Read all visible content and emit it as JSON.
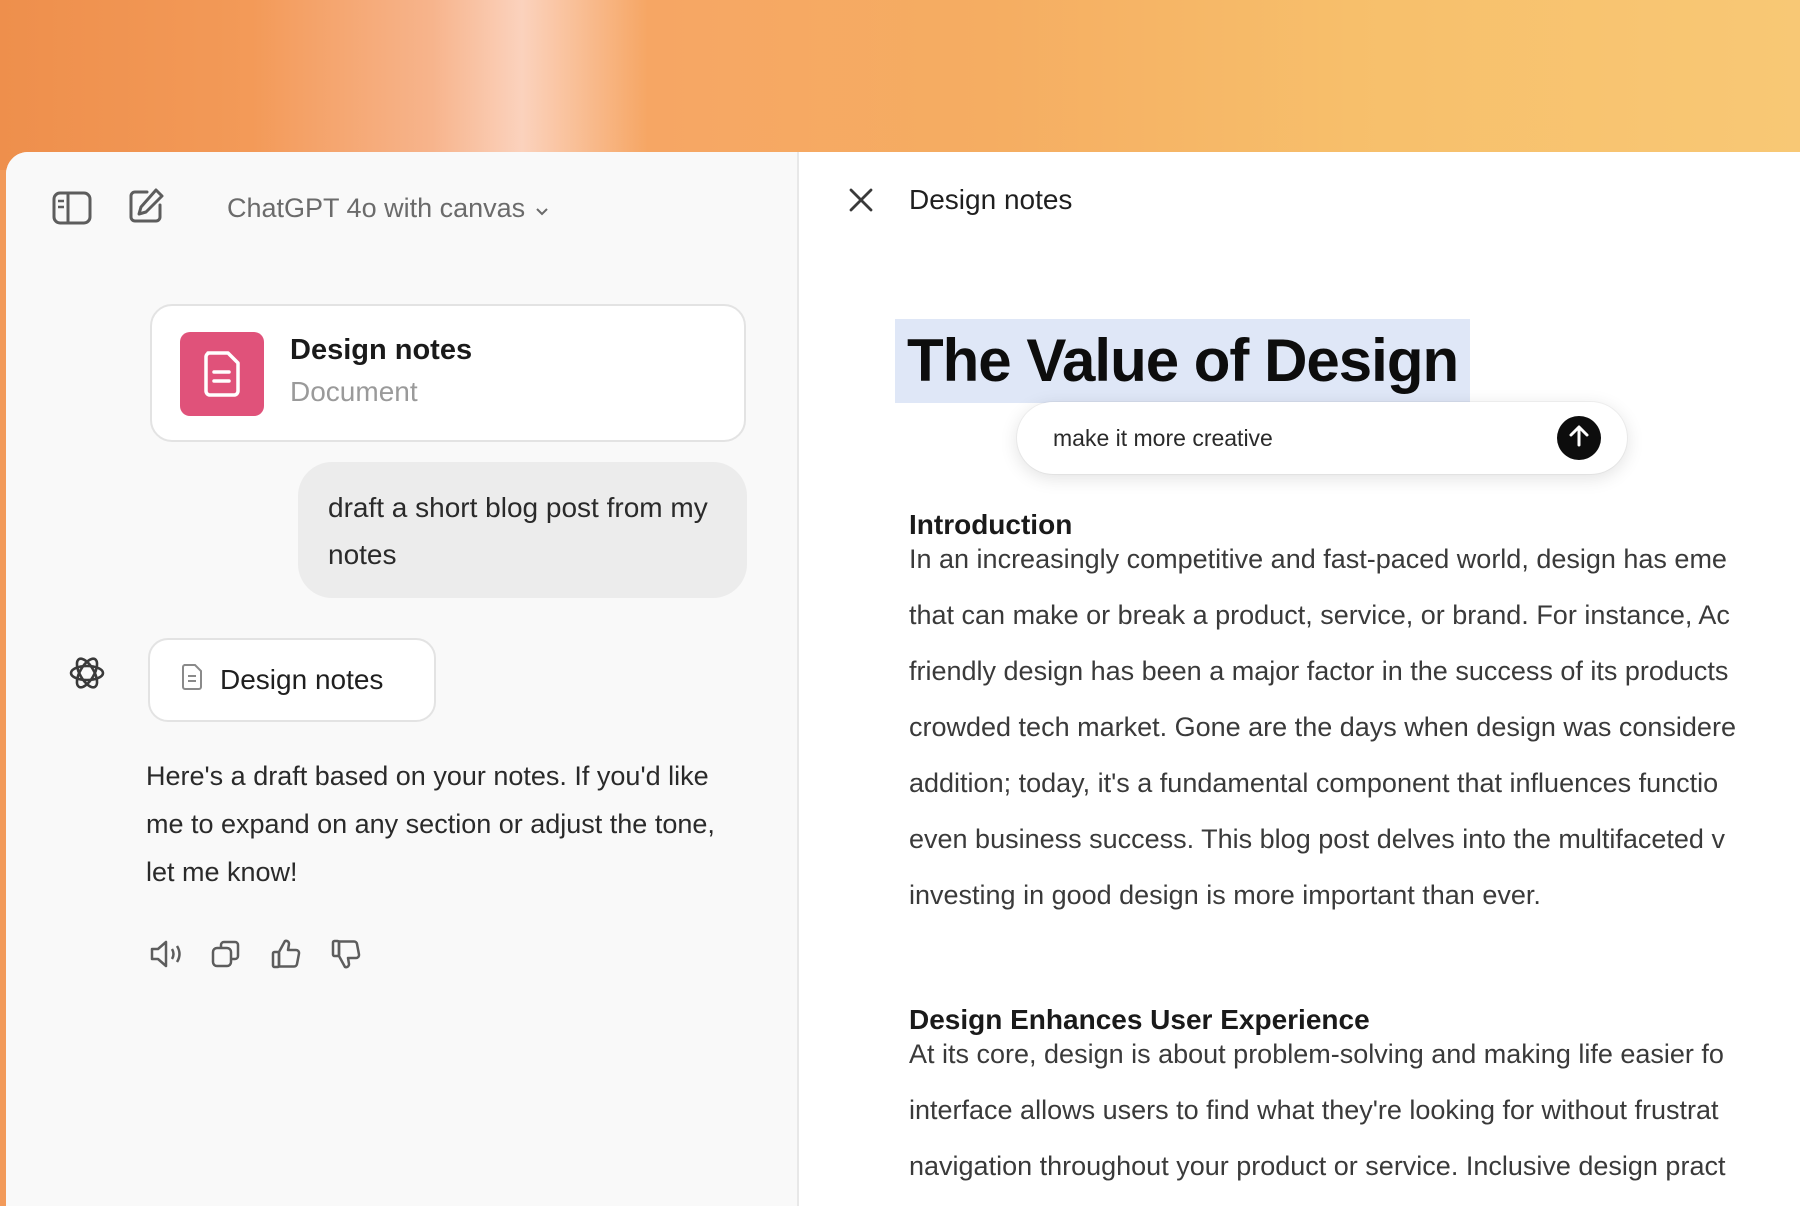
{
  "header": {
    "model_label": "ChatGPT 4o with canvas"
  },
  "icons": {
    "sidebar": "sidebar-toggle-icon",
    "new_chat": "edit-icon",
    "chevron": "chevron-down-icon",
    "document": "document-icon",
    "assistant": "openai-logo-icon",
    "read_aloud": "speaker-icon",
    "copy": "copy-icon",
    "thumbs_up": "thumbs-up-icon",
    "thumbs_down": "thumbs-down-icon",
    "close": "close-icon",
    "send": "arrow-up-icon"
  },
  "chat": {
    "doc_card": {
      "title": "Design notes",
      "subtitle": "Document"
    },
    "user_message": "draft a short blog post from my notes",
    "doc_pill_label": "Design notes",
    "assistant_message": "Here's a draft based on your notes. If you'd like me to expand on any section or adjust the tone, let me know!"
  },
  "canvas": {
    "title": "Design notes",
    "heading": "The Value of Design",
    "prompt_input": "make it more creative",
    "sections": [
      {
        "heading": "Introduction",
        "lines": [
          "In an increasingly competitive and fast-paced world, design has eme",
          "that can make or break a product, service, or brand. For instance, Ac",
          "friendly design has been a major factor in the success of its products",
          "crowded tech market. Gone are the days when design was considere",
          "addition; today, it's a fundamental component that influences functio",
          "even business success. This blog post delves into the multifaceted v",
          "investing in good design is more important than ever."
        ]
      },
      {
        "heading": "Design Enhances User Experience",
        "lines": [
          "At its core, design is about problem-solving and making life easier fo",
          "interface allows users to find what they're looking for without frustrat",
          "navigation throughout your product or service. Inclusive design pract"
        ]
      }
    ]
  },
  "colors": {
    "doc_icon_bg": "#e0527a",
    "highlight": "#dfe7f7",
    "send_button": "#0d0d0d"
  }
}
